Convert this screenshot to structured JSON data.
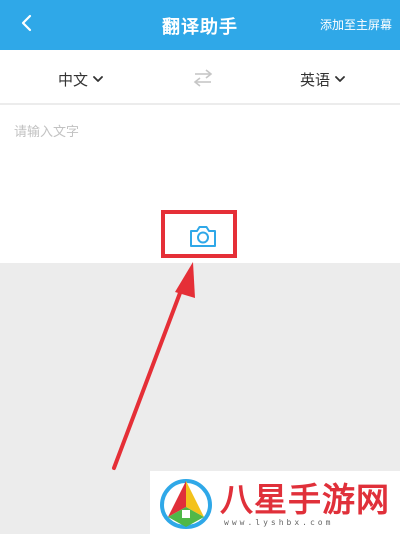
{
  "header": {
    "back_icon": "chevron-left-icon",
    "title": "翻译助手",
    "add_to_home": "添加至主屏幕"
  },
  "lang_bar": {
    "source": "中文",
    "target": "英语",
    "swap_icon": "swap-arrows-icon"
  },
  "input": {
    "placeholder": "请输入文字",
    "camera_icon": "camera-icon"
  },
  "annotation": {
    "color": "#e52f37"
  },
  "watermark": {
    "brand": "八星手游网",
    "url": "www.lyshbx.com"
  },
  "colors": {
    "header": "#2fa8e8",
    "camera": "#2fa8e8"
  }
}
